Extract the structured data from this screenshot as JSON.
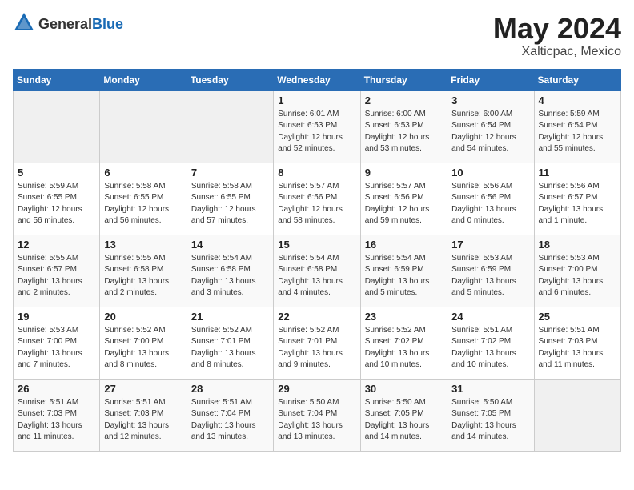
{
  "header": {
    "logo_general": "General",
    "logo_blue": "Blue",
    "month_year": "May 2024",
    "location": "Xalticpac, Mexico"
  },
  "days_of_week": [
    "Sunday",
    "Monday",
    "Tuesday",
    "Wednesday",
    "Thursday",
    "Friday",
    "Saturday"
  ],
  "weeks": [
    [
      {
        "day": "",
        "info": ""
      },
      {
        "day": "",
        "info": ""
      },
      {
        "day": "",
        "info": ""
      },
      {
        "day": "1",
        "info": "Sunrise: 6:01 AM\nSunset: 6:53 PM\nDaylight: 12 hours\nand 52 minutes."
      },
      {
        "day": "2",
        "info": "Sunrise: 6:00 AM\nSunset: 6:53 PM\nDaylight: 12 hours\nand 53 minutes."
      },
      {
        "day": "3",
        "info": "Sunrise: 6:00 AM\nSunset: 6:54 PM\nDaylight: 12 hours\nand 54 minutes."
      },
      {
        "day": "4",
        "info": "Sunrise: 5:59 AM\nSunset: 6:54 PM\nDaylight: 12 hours\nand 55 minutes."
      }
    ],
    [
      {
        "day": "5",
        "info": "Sunrise: 5:59 AM\nSunset: 6:55 PM\nDaylight: 12 hours\nand 56 minutes."
      },
      {
        "day": "6",
        "info": "Sunrise: 5:58 AM\nSunset: 6:55 PM\nDaylight: 12 hours\nand 56 minutes."
      },
      {
        "day": "7",
        "info": "Sunrise: 5:58 AM\nSunset: 6:55 PM\nDaylight: 12 hours\nand 57 minutes."
      },
      {
        "day": "8",
        "info": "Sunrise: 5:57 AM\nSunset: 6:56 PM\nDaylight: 12 hours\nand 58 minutes."
      },
      {
        "day": "9",
        "info": "Sunrise: 5:57 AM\nSunset: 6:56 PM\nDaylight: 12 hours\nand 59 minutes."
      },
      {
        "day": "10",
        "info": "Sunrise: 5:56 AM\nSunset: 6:56 PM\nDaylight: 13 hours\nand 0 minutes."
      },
      {
        "day": "11",
        "info": "Sunrise: 5:56 AM\nSunset: 6:57 PM\nDaylight: 13 hours\nand 1 minute."
      }
    ],
    [
      {
        "day": "12",
        "info": "Sunrise: 5:55 AM\nSunset: 6:57 PM\nDaylight: 13 hours\nand 2 minutes."
      },
      {
        "day": "13",
        "info": "Sunrise: 5:55 AM\nSunset: 6:58 PM\nDaylight: 13 hours\nand 2 minutes."
      },
      {
        "day": "14",
        "info": "Sunrise: 5:54 AM\nSunset: 6:58 PM\nDaylight: 13 hours\nand 3 minutes."
      },
      {
        "day": "15",
        "info": "Sunrise: 5:54 AM\nSunset: 6:58 PM\nDaylight: 13 hours\nand 4 minutes."
      },
      {
        "day": "16",
        "info": "Sunrise: 5:54 AM\nSunset: 6:59 PM\nDaylight: 13 hours\nand 5 minutes."
      },
      {
        "day": "17",
        "info": "Sunrise: 5:53 AM\nSunset: 6:59 PM\nDaylight: 13 hours\nand 5 minutes."
      },
      {
        "day": "18",
        "info": "Sunrise: 5:53 AM\nSunset: 7:00 PM\nDaylight: 13 hours\nand 6 minutes."
      }
    ],
    [
      {
        "day": "19",
        "info": "Sunrise: 5:53 AM\nSunset: 7:00 PM\nDaylight: 13 hours\nand 7 minutes."
      },
      {
        "day": "20",
        "info": "Sunrise: 5:52 AM\nSunset: 7:00 PM\nDaylight: 13 hours\nand 8 minutes."
      },
      {
        "day": "21",
        "info": "Sunrise: 5:52 AM\nSunset: 7:01 PM\nDaylight: 13 hours\nand 8 minutes."
      },
      {
        "day": "22",
        "info": "Sunrise: 5:52 AM\nSunset: 7:01 PM\nDaylight: 13 hours\nand 9 minutes."
      },
      {
        "day": "23",
        "info": "Sunrise: 5:52 AM\nSunset: 7:02 PM\nDaylight: 13 hours\nand 10 minutes."
      },
      {
        "day": "24",
        "info": "Sunrise: 5:51 AM\nSunset: 7:02 PM\nDaylight: 13 hours\nand 10 minutes."
      },
      {
        "day": "25",
        "info": "Sunrise: 5:51 AM\nSunset: 7:03 PM\nDaylight: 13 hours\nand 11 minutes."
      }
    ],
    [
      {
        "day": "26",
        "info": "Sunrise: 5:51 AM\nSunset: 7:03 PM\nDaylight: 13 hours\nand 11 minutes."
      },
      {
        "day": "27",
        "info": "Sunrise: 5:51 AM\nSunset: 7:03 PM\nDaylight: 13 hours\nand 12 minutes."
      },
      {
        "day": "28",
        "info": "Sunrise: 5:51 AM\nSunset: 7:04 PM\nDaylight: 13 hours\nand 13 minutes."
      },
      {
        "day": "29",
        "info": "Sunrise: 5:50 AM\nSunset: 7:04 PM\nDaylight: 13 hours\nand 13 minutes."
      },
      {
        "day": "30",
        "info": "Sunrise: 5:50 AM\nSunset: 7:05 PM\nDaylight: 13 hours\nand 14 minutes."
      },
      {
        "day": "31",
        "info": "Sunrise: 5:50 AM\nSunset: 7:05 PM\nDaylight: 13 hours\nand 14 minutes."
      },
      {
        "day": "",
        "info": ""
      }
    ]
  ]
}
